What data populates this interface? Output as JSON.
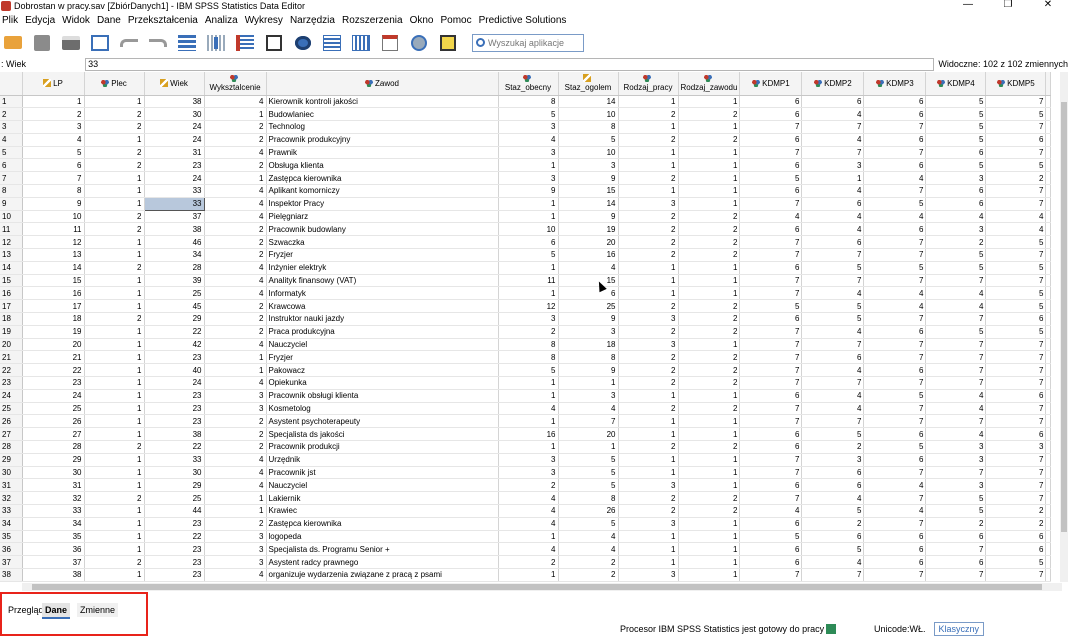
{
  "window": {
    "title": "Dobrostan w pracy.sav [ZbiórDanych1] - IBM SPSS Statistics Data Editor",
    "controls": [
      "—",
      "❐",
      "✕"
    ]
  },
  "menu": [
    "Plik",
    "Edycja",
    "Widok",
    "Dane",
    "Przekształcenia",
    "Analiza",
    "Wykresy",
    "Narzędzia",
    "Rozszerzenia",
    "Okno",
    "Pomoc",
    "Predictive Solutions"
  ],
  "toolbar": {
    "search_placeholder": "Wyszukaj aplikacje",
    "icons": [
      "open-folder-icon",
      "save-icon",
      "print-icon",
      "dialog-recall-icon",
      "undo-icon",
      "redo-icon",
      "goto-case-icon",
      "goto-variable-icon",
      "variables-icon",
      "run-descriptives-icon",
      "find-icon",
      "insert-cases-icon",
      "insert-variable-icon",
      "split-file-icon",
      "weight-cases-icon",
      "value-labels-icon",
      "use-variable-sets-icon",
      "spell-icon"
    ]
  },
  "cell_editor": {
    "var_label": ": Wiek",
    "value": "33",
    "visible_text": "Widoczne: 102 z 102 zmiennych"
  },
  "columns": [
    {
      "name": "LP",
      "type": "ruler"
    },
    {
      "name": "Plec",
      "type": "nom"
    },
    {
      "name": "Wiek",
      "type": "ruler"
    },
    {
      "name": "Wyksztalcenie",
      "type": "nom"
    },
    {
      "name": "Zawod",
      "type": "nom"
    },
    {
      "name": "Staz_obecny",
      "type": "nom"
    },
    {
      "name": "Staz_ogolem",
      "type": "ruler"
    },
    {
      "name": "Rodzaj_pracy",
      "type": "nom"
    },
    {
      "name": "Rodzaj_zawodu",
      "type": "nom"
    },
    {
      "name": "KDMP1",
      "type": "nom"
    },
    {
      "name": "KDMP2",
      "type": "nom"
    },
    {
      "name": "KDMP3",
      "type": "nom"
    },
    {
      "name": "KDMP4",
      "type": "nom"
    },
    {
      "name": "KDMP5",
      "type": "nom"
    }
  ],
  "rows": [
    [
      "1",
      "1",
      "38",
      "4",
      "Kierownik kontroli jakości",
      "8",
      "14",
      "1",
      "1",
      "6",
      "6",
      "6",
      "5",
      "7"
    ],
    [
      "2",
      "2",
      "30",
      "1",
      "Budowlaniec",
      "5",
      "10",
      "2",
      "2",
      "6",
      "4",
      "6",
      "5",
      "5"
    ],
    [
      "3",
      "2",
      "24",
      "2",
      "Technolog",
      "3",
      "8",
      "1",
      "1",
      "7",
      "7",
      "7",
      "5",
      "7"
    ],
    [
      "4",
      "1",
      "24",
      "2",
      "Pracownik produkcyjny",
      "4",
      "5",
      "2",
      "2",
      "6",
      "4",
      "6",
      "5",
      "6"
    ],
    [
      "5",
      "2",
      "31",
      "4",
      "Prawnik",
      "3",
      "10",
      "1",
      "1",
      "7",
      "7",
      "7",
      "6",
      "7"
    ],
    [
      "6",
      "2",
      "23",
      "2",
      "Obsługa klienta",
      "1",
      "3",
      "1",
      "1",
      "6",
      "3",
      "6",
      "5",
      "5"
    ],
    [
      "7",
      "1",
      "24",
      "1",
      "Zastępca kierownika",
      "3",
      "9",
      "2",
      "1",
      "5",
      "1",
      "4",
      "3",
      "2"
    ],
    [
      "8",
      "1",
      "33",
      "4",
      "Aplikant komorniczy",
      "9",
      "15",
      "1",
      "1",
      "6",
      "4",
      "7",
      "6",
      "7"
    ],
    [
      "9",
      "1",
      "33",
      "4",
      "Inspektor Pracy",
      "1",
      "14",
      "3",
      "1",
      "7",
      "6",
      "5",
      "6",
      "7"
    ],
    [
      "10",
      "2",
      "37",
      "4",
      "Pielęgniarz",
      "1",
      "9",
      "2",
      "2",
      "4",
      "4",
      "4",
      "4",
      "4"
    ],
    [
      "11",
      "2",
      "38",
      "2",
      "Pracownik budowlany",
      "10",
      "19",
      "2",
      "2",
      "6",
      "4",
      "6",
      "3",
      "4"
    ],
    [
      "12",
      "1",
      "46",
      "2",
      "Szwaczka",
      "6",
      "20",
      "2",
      "2",
      "7",
      "6",
      "7",
      "2",
      "5"
    ],
    [
      "13",
      "1",
      "34",
      "2",
      "Fryzjer",
      "5",
      "16",
      "2",
      "2",
      "7",
      "7",
      "7",
      "5",
      "7"
    ],
    [
      "14",
      "2",
      "28",
      "4",
      "Inżynier elektryk",
      "1",
      "4",
      "1",
      "1",
      "6",
      "5",
      "5",
      "5",
      "5"
    ],
    [
      "15",
      "1",
      "39",
      "4",
      "Analityk finansowy (VAT)",
      "11",
      "15",
      "1",
      "1",
      "7",
      "7",
      "7",
      "7",
      "7"
    ],
    [
      "16",
      "1",
      "25",
      "4",
      "Informatyk",
      "1",
      "6",
      "1",
      "1",
      "7",
      "4",
      "4",
      "4",
      "5"
    ],
    [
      "17",
      "1",
      "45",
      "2",
      "Krawcowa",
      "12",
      "25",
      "2",
      "2",
      "5",
      "5",
      "4",
      "4",
      "5"
    ],
    [
      "18",
      "2",
      "29",
      "2",
      "Instruktor nauki jazdy",
      "3",
      "9",
      "3",
      "2",
      "6",
      "5",
      "7",
      "7",
      "6"
    ],
    [
      "19",
      "1",
      "22",
      "2",
      "Praca produkcyjna",
      "2",
      "3",
      "2",
      "2",
      "7",
      "4",
      "6",
      "5",
      "5"
    ],
    [
      "20",
      "1",
      "42",
      "4",
      "Nauczyciel",
      "8",
      "18",
      "3",
      "1",
      "7",
      "7",
      "7",
      "7",
      "7"
    ],
    [
      "21",
      "1",
      "23",
      "1",
      "Fryzjer",
      "8",
      "8",
      "2",
      "2",
      "7",
      "6",
      "7",
      "7",
      "7"
    ],
    [
      "22",
      "1",
      "40",
      "1",
      "Pakowacz",
      "5",
      "9",
      "2",
      "2",
      "7",
      "4",
      "6",
      "7",
      "7"
    ],
    [
      "23",
      "1",
      "24",
      "4",
      "Opiekunka",
      "1",
      "1",
      "2",
      "2",
      "7",
      "7",
      "7",
      "7",
      "7"
    ],
    [
      "24",
      "1",
      "23",
      "3",
      "Pracownik obsługi klienta",
      "1",
      "3",
      "1",
      "1",
      "6",
      "4",
      "5",
      "4",
      "6"
    ],
    [
      "25",
      "1",
      "23",
      "3",
      "Kosmetolog",
      "4",
      "4",
      "2",
      "2",
      "7",
      "4",
      "7",
      "4",
      "7"
    ],
    [
      "26",
      "1",
      "23",
      "2",
      "Asystent psychoterapeuty",
      "1",
      "7",
      "1",
      "1",
      "7",
      "7",
      "7",
      "7",
      "7"
    ],
    [
      "27",
      "1",
      "38",
      "2",
      "Specjalista ds jakości",
      "16",
      "20",
      "1",
      "1",
      "6",
      "5",
      "6",
      "4",
      "6"
    ],
    [
      "28",
      "2",
      "22",
      "2",
      "Pracownik produkcji",
      "1",
      "1",
      "2",
      "2",
      "6",
      "2",
      "5",
      "3",
      "3"
    ],
    [
      "29",
      "1",
      "33",
      "4",
      "Urzędnik",
      "3",
      "5",
      "1",
      "1",
      "7",
      "3",
      "6",
      "3",
      "7"
    ],
    [
      "30",
      "1",
      "30",
      "4",
      "Pracownik jst",
      "3",
      "5",
      "1",
      "1",
      "7",
      "6",
      "7",
      "7",
      "7"
    ],
    [
      "31",
      "1",
      "29",
      "4",
      "Nauczyciel",
      "2",
      "5",
      "3",
      "1",
      "6",
      "6",
      "4",
      "3",
      "7"
    ],
    [
      "32",
      "2",
      "25",
      "1",
      "Lakiernik",
      "4",
      "8",
      "2",
      "2",
      "7",
      "4",
      "7",
      "5",
      "7"
    ],
    [
      "33",
      "1",
      "44",
      "1",
      "Krawiec",
      "4",
      "26",
      "2",
      "2",
      "4",
      "5",
      "4",
      "5",
      "2"
    ],
    [
      "34",
      "1",
      "23",
      "2",
      "Zastępca kierownika",
      "4",
      "5",
      "3",
      "1",
      "6",
      "2",
      "7",
      "2",
      "2"
    ],
    [
      "35",
      "1",
      "22",
      "3",
      "logopeda",
      "1",
      "4",
      "1",
      "1",
      "5",
      "6",
      "6",
      "6",
      "6"
    ],
    [
      "36",
      "1",
      "23",
      "3",
      "Specjalista ds. Programu Senior +",
      "4",
      "4",
      "1",
      "1",
      "6",
      "5",
      "6",
      "7",
      "6"
    ],
    [
      "37",
      "2",
      "23",
      "3",
      "Asystent radcy prawnego",
      "2",
      "2",
      "1",
      "1",
      "6",
      "4",
      "6",
      "6",
      "5"
    ],
    [
      "38",
      "1",
      "23",
      "4",
      "organizuje wydarzenia związane z pracą z psami",
      "1",
      "2",
      "3",
      "1",
      "7",
      "7",
      "7",
      "7",
      "7"
    ]
  ],
  "selected_row": 9,
  "tabs": [
    "Przegląd",
    "Dane",
    "Zmienne"
  ],
  "status": {
    "processor": "Procesor IBM SPSS Statistics  jest gotowy do pracy",
    "unicode": "Unicode:WŁ.",
    "mode": "Klasyczny"
  }
}
